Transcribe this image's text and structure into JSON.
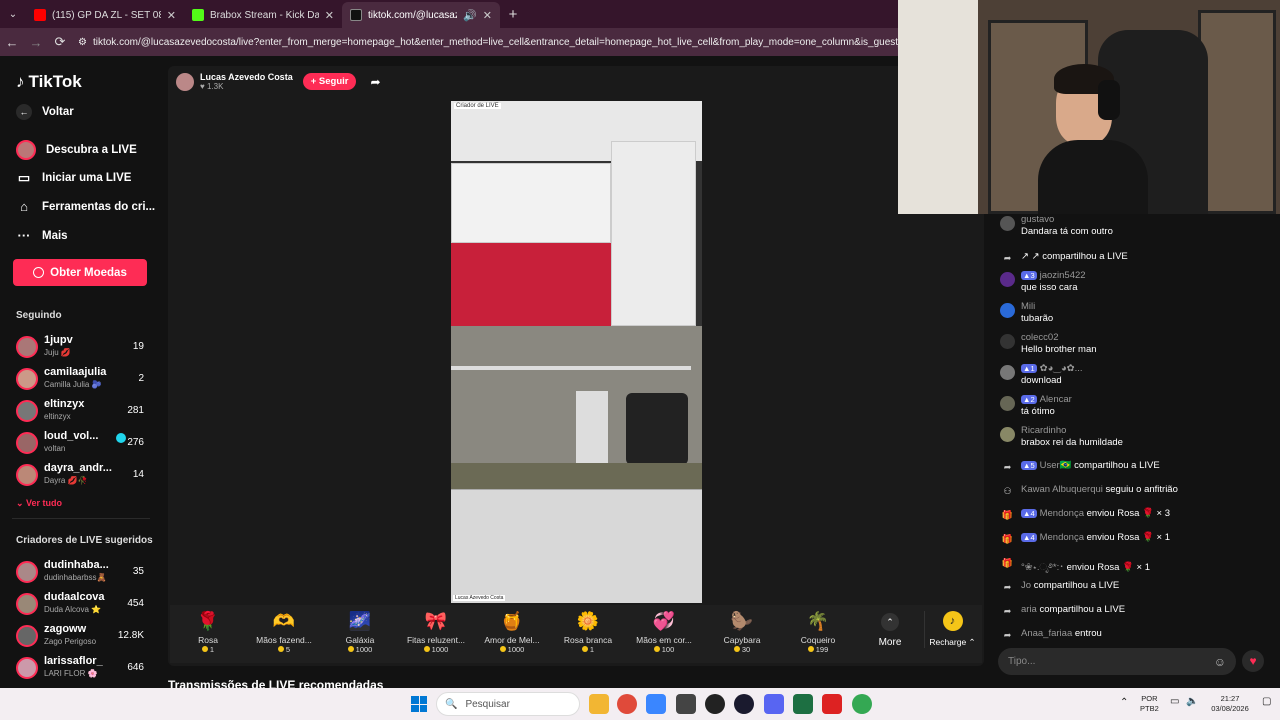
{
  "browser": {
    "tabs": [
      {
        "title": "(115) GP DA ZL - SET 0800 \"NO",
        "icon_color": "#ff0000",
        "active": false
      },
      {
        "title": "Brabox Stream - Kick Dashboard",
        "icon_color": "#53fc18",
        "active": false
      },
      {
        "title": "tiktok.com/@lucasazevedo",
        "icon_color": "#111111",
        "active": true
      }
    ],
    "new_tab": "+",
    "url": "tiktok.com/@lucasazevedocosta/live?enter_from_merge=homepage_hot&enter_method=live_cell&entrance_detail=homepage_hot_live_cell&from_play_mode=one_column&is_guest_connect=1"
  },
  "sidebar": {
    "logo": "TikTok",
    "nav": [
      {
        "label": "Voltar",
        "icon": "back-arrow-icon"
      },
      {
        "label": "Descubra a LIVE",
        "icon": "live-avatar-icon"
      },
      {
        "label": "Iniciar uma LIVE",
        "icon": "video-camera-icon"
      },
      {
        "label": "Ferramentas do cri...",
        "icon": "home-icon"
      },
      {
        "label": "Mais",
        "icon": "more-dots-icon"
      }
    ],
    "coins_button": "Obter Moedas",
    "following_title": "Seguindo",
    "following": [
      {
        "name": "1jupv",
        "sub": "Juju 💋",
        "count": "19",
        "color": "#a77"
      },
      {
        "name": "camilaajulia",
        "sub": "Camilla Julia 🫐",
        "count": "2",
        "color": "#c98"
      },
      {
        "name": "eltinzyx",
        "sub": "eltinzyx",
        "count": "281",
        "color": "#777"
      },
      {
        "name": "loud_vol...",
        "sub": "voltan",
        "count": "276",
        "color": "#966"
      },
      {
        "name": "dayra_andr...",
        "sub": "Dayra 💋🥀",
        "count": "14",
        "color": "#b87"
      }
    ],
    "see_all": "Ver tudo",
    "suggested_title": "Criadores de LIVE sugeridos",
    "suggested": [
      {
        "name": "dudinhaba...",
        "sub": "dudinhabarbss🧸",
        "count": "35",
        "color": "#a88"
      },
      {
        "name": "dudaalcova",
        "sub": "Duda Alcova ⭐",
        "count": "454",
        "color": "#987"
      },
      {
        "name": "zagoww",
        "sub": "Zago Perigoso",
        "count": "12.8K",
        "color": "#666"
      },
      {
        "name": "larissaflor_",
        "sub": "LARI FLOR 🌸",
        "count": "646",
        "color": "#c9a"
      }
    ]
  },
  "stream": {
    "host_name": "Lucas Azevedo Costa",
    "host_likes": "1.3K",
    "follow_label": "+ Seguir",
    "video_tag": "Criador de LIVE",
    "video_footer": "Lucas Azevedo Costa",
    "recommended_title": "Transmissões de LIVE recomendadas"
  },
  "gifts": [
    {
      "name": "Rosa",
      "price": "1",
      "icon": "🌹"
    },
    {
      "name": "Mãos fazend...",
      "price": "5",
      "icon": "🫶"
    },
    {
      "name": "Galáxia",
      "price": "1000",
      "icon": "🌌"
    },
    {
      "name": "Fitas reluzent...",
      "price": "1000",
      "icon": "🎀"
    },
    {
      "name": "Amor de Mel...",
      "price": "1000",
      "icon": "🍯"
    },
    {
      "name": "Rosa branca",
      "price": "1",
      "icon": "🌼"
    },
    {
      "name": "Mãos em cor...",
      "price": "100",
      "icon": "💞"
    },
    {
      "name": "Capybara",
      "price": "30",
      "icon": "🦫"
    },
    {
      "name": "Coqueiro",
      "price": "199",
      "icon": "🌴"
    }
  ],
  "more_label": "More",
  "recharge_label": "Recharge ⌃",
  "chat": {
    "messages": [
      {
        "user": "gustavo",
        "text": "Dandara tá com outro",
        "icon": "avatar"
      },
      {
        "user": "",
        "text": "↗ ↗ compartilhou a LIVE",
        "icon": "share-icon"
      },
      {
        "level": "3",
        "user": "jaozin5422",
        "text": "que isso cara",
        "icon": "avatar"
      },
      {
        "user": "Mili",
        "text": "tubarão",
        "icon": "avatar"
      },
      {
        "user": "colecc02",
        "text": "Hello brother man",
        "icon": "avatar"
      },
      {
        "level": "1",
        "user": "✿◕‿◕✿...",
        "text": "download",
        "icon": "avatar"
      },
      {
        "level": "2",
        "user": "Alencar",
        "text": "tá ótimo",
        "icon": "avatar"
      },
      {
        "user": "Ricardinho",
        "text": "brabox rei da humildade",
        "icon": "avatar"
      },
      {
        "level": "5",
        "user": "User🇧🇷",
        "text": "compartilhou a LIVE",
        "icon": "share-icon"
      },
      {
        "user": "Kawan Albuquerqui",
        "text": "seguiu o anfitrião",
        "icon": "follow-icon"
      },
      {
        "level": "4",
        "user": "Mendonça",
        "text": "enviou Rosa 🌹 × 3",
        "icon": "gift-icon"
      },
      {
        "level": "4",
        "user": "Mendonça",
        "text": "enviou Rosa 🌹 × 1",
        "icon": "gift-icon"
      },
      {
        "user": "°❀⋆.ೃ࿔*:･",
        "text": "enviou Rosa 🌹 × 1",
        "icon": "gift-icon"
      },
      {
        "user": "Jo",
        "text": "compartilhou a LIVE",
        "icon": "share-icon"
      },
      {
        "user": "aria",
        "text": "compartilhou a LIVE",
        "icon": "share-icon"
      },
      {
        "user": "Anaa_fariaa",
        "text": "entrou",
        "icon": "share-icon"
      }
    ],
    "input_placeholder": "Tipo..."
  },
  "taskbar": {
    "search_placeholder": "Pesquisar",
    "lang": "POR",
    "layout": "PTB2",
    "time": "21:27",
    "date": "03/08/2026"
  }
}
